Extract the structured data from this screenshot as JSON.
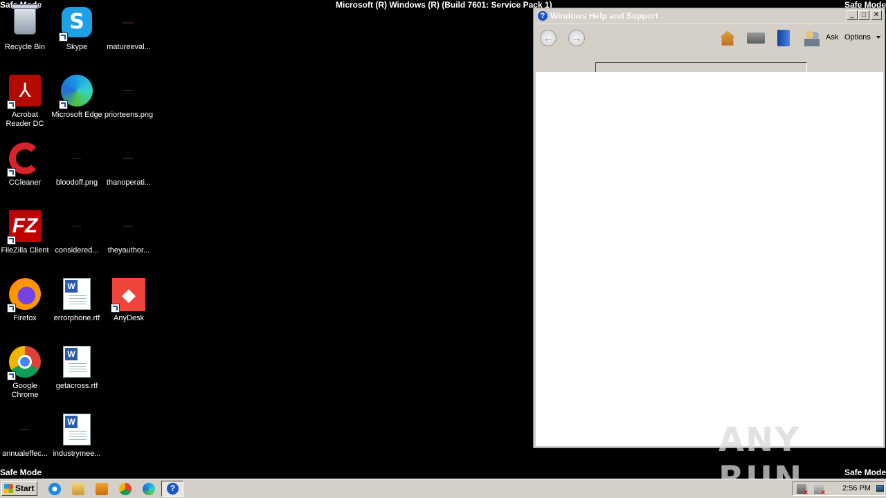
{
  "overlay": {
    "safe_mode": "Safe Mode",
    "build": "Microsoft (R) Windows (R) (Build 7601: Service Pack 1)"
  },
  "desktop": {
    "icons": [
      {
        "label": "Recycle Bin",
        "icon": "recycle-bin-icon"
      },
      {
        "label": "Skype",
        "icon": "skype-icon"
      },
      {
        "label": "matureeval...",
        "icon": "image-file-icon"
      },
      {
        "label": "Acrobat Reader DC",
        "icon": "acrobat-icon"
      },
      {
        "label": "Microsoft Edge",
        "icon": "edge-icon"
      },
      {
        "label": "priorteens.png",
        "icon": "image-file-icon"
      },
      {
        "label": "CCleaner",
        "icon": "ccleaner-icon"
      },
      {
        "label": "bloodoff.png",
        "icon": "image-file-icon"
      },
      {
        "label": "thanoperati...",
        "icon": "image-file-icon"
      },
      {
        "label": "FileZilla Client",
        "icon": "filezilla-icon"
      },
      {
        "label": "considered...",
        "icon": "image-file-icon"
      },
      {
        "label": "theyauthor...",
        "icon": "image-file-icon"
      },
      {
        "label": "Firefox",
        "icon": "firefox-icon"
      },
      {
        "label": "errorphone.rtf",
        "icon": "word-document-icon"
      },
      {
        "label": "AnyDesk",
        "icon": "anydesk-icon"
      },
      {
        "label": "Google Chrome",
        "icon": "chrome-icon"
      },
      {
        "label": "getacross.rtf",
        "icon": "word-document-icon"
      },
      {
        "label": "annualeffec...",
        "icon": "image-file-icon"
      },
      {
        "label": "industrymee...",
        "icon": "word-document-icon"
      }
    ]
  },
  "help_window": {
    "title": "Windows Help and Support",
    "ask_label": "Ask",
    "options_label": "Options",
    "search_value": ""
  },
  "watermark": "ANY RUN",
  "taskbar": {
    "start_label": "Start",
    "clock": "2:56 PM"
  }
}
